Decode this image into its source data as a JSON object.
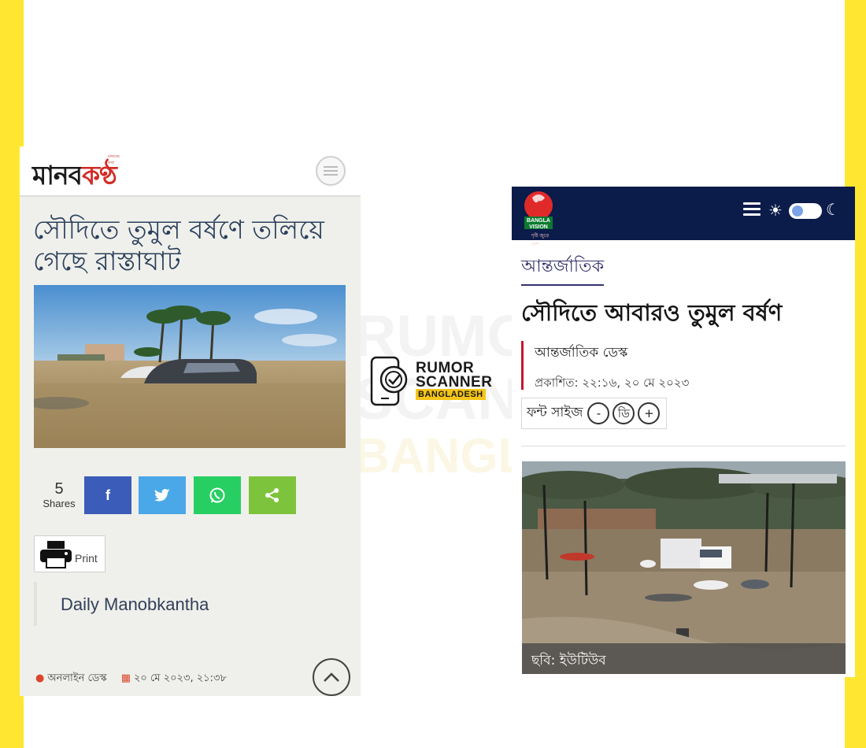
{
  "left_site": {
    "logo_text_dark": "মানব",
    "logo_text_red": "কণ্ঠ",
    "logo_tagline": "মানবের কথা শুনুন",
    "headline": "সৌদিতে তুমুল বর্ষণে তলিয়ে গেছে রাস্তাঘাট",
    "share_count": "5",
    "shares_label": "Shares",
    "share_buttons": [
      {
        "name": "facebook",
        "color": "#3b5cb8"
      },
      {
        "name": "twitter",
        "color": "#4aa8e8"
      },
      {
        "name": "whatsapp",
        "color": "#27cf62"
      },
      {
        "name": "share",
        "color": "#7ec33c"
      }
    ],
    "print_label": "Print",
    "source": "Daily Manobkantha",
    "author": "অনলাইন ডেস্ক",
    "date": "২০ মে ২০২৩, ২১:৩৮"
  },
  "watermark": {
    "line1": "RUMOR",
    "line2": "SCANNER",
    "line3": "BANGLADESH"
  },
  "right_site": {
    "logo_line1": "BANGLA",
    "logo_line2": "VISION",
    "logo_tagline": "দৃষ্টি জুড়ে দেশ",
    "category": "আন্তর্জাতিক",
    "headline": "সৌদিতে আবারও তুমুল বর্ষণ",
    "author": "আন্তর্জাতিক ডেস্ক",
    "published": "প্রকাশিত: ২২:১৬, ২০ মে ২০২৩",
    "font_size_label": "ফন্ট সাইজ",
    "font_decrease": "-",
    "font_default": "ডি",
    "font_increase": "+",
    "caption": "ছবি: ইউটিউব"
  },
  "colors": {
    "frame_yellow": "#ffe630",
    "left_bg": "#eff0eb",
    "right_header": "#0b1b4a",
    "accent_red": "#c2182f"
  }
}
